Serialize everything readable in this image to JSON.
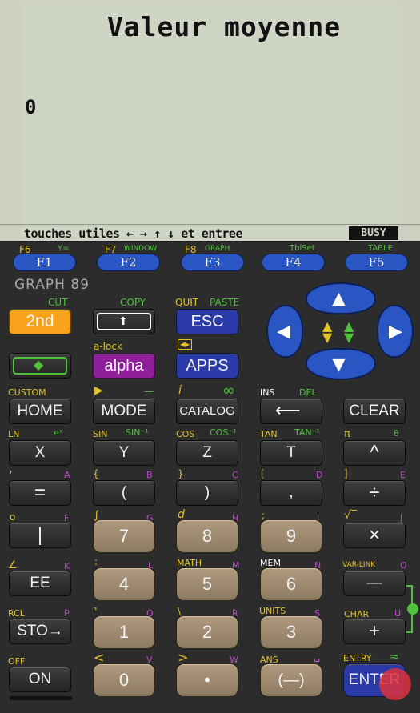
{
  "screen": {
    "title": "Valeur moyenne",
    "value": "0",
    "help": "touches utiles ← → ↑ ↓ et entree",
    "status": "BUSY"
  },
  "fkeys": [
    {
      "label": "F1",
      "top_left": "F6",
      "top_right": "Y="
    },
    {
      "label": "F2",
      "top_left": "F7",
      "top_right": "WINDOW"
    },
    {
      "label": "F3",
      "top_left": "F8",
      "top_right": "GRAPH"
    },
    {
      "label": "F4",
      "top_left": "",
      "top_right": "TblSet"
    },
    {
      "label": "F5",
      "top_left": "",
      "top_right": "TABLE"
    }
  ],
  "brand": "GRAPH 89",
  "row1": {
    "second": {
      "label": "2nd",
      "over_right": "CUT"
    },
    "shift": {
      "over_right": "COPY"
    },
    "esc": {
      "label": "ESC",
      "over_left": "QUIT",
      "over_right": "PASTE"
    }
  },
  "row2": {
    "diamond": {},
    "alpha": {
      "label": "alpha",
      "over_left": "a-lock"
    },
    "apps": {
      "label": "APPS"
    }
  },
  "row3": {
    "home": {
      "label": "HOME",
      "over_left": "CUSTOM"
    },
    "mode": {
      "label": "MODE",
      "over_right": "—"
    },
    "catalog": {
      "label": "CATALOG",
      "over_left": "i",
      "over_right": "∞"
    },
    "backspace": {
      "over_left": "INS",
      "over_right": "DEL"
    },
    "clear": {
      "label": "CLEAR"
    }
  },
  "row4": [
    {
      "label": "X",
      "over_left": "LN",
      "over_right": "eˣ"
    },
    {
      "label": "Y",
      "over_left": "SIN",
      "over_right": "SIN⁻¹"
    },
    {
      "label": "Z",
      "over_left": "COS",
      "over_right": "COS⁻¹"
    },
    {
      "label": "T",
      "over_left": "TAN",
      "over_right": "TAN⁻¹"
    },
    {
      "label": "^",
      "over_left": "π",
      "over_right": "θ"
    }
  ],
  "row5": [
    {
      "label": "=",
      "over_left": "'",
      "over_right": "A"
    },
    {
      "label": "(",
      "over_left": "{",
      "over_right": "B"
    },
    {
      "label": ")",
      "over_left": "}",
      "over_right": "C"
    },
    {
      "label": ",",
      "over_left": "[",
      "over_right": "D"
    },
    {
      "label": "÷",
      "over_left": "]",
      "over_right": "E"
    }
  ],
  "row6": [
    {
      "label": "|",
      "over_left": "o",
      "over_right": "F"
    },
    {
      "label": "7",
      "over_left": "∫",
      "over_right": "G"
    },
    {
      "label": "8",
      "over_left": "d",
      "over_right": "H"
    },
    {
      "label": "9",
      "over_left": ";",
      "over_right": "I"
    },
    {
      "label": "×",
      "over_left": "√‾",
      "over_right": "J"
    }
  ],
  "row7": [
    {
      "label": "EE",
      "over_left": "∠",
      "over_right": "K"
    },
    {
      "label": "4",
      "over_left": ":",
      "over_right": "L"
    },
    {
      "label": "5",
      "over_left": "MATH",
      "over_right": "M"
    },
    {
      "label": "6",
      "over_left": "MEM",
      "over_right": "N"
    },
    {
      "label": "—",
      "over_left": "VAR-LINK",
      "over_right": "O"
    }
  ],
  "row8": [
    {
      "label": "STO→",
      "over_left": "RCL",
      "over_right": "P"
    },
    {
      "label": "1",
      "over_left": "\"",
      "over_right": "Q"
    },
    {
      "label": "2",
      "over_left": "\\",
      "over_right": "R"
    },
    {
      "label": "3",
      "over_left": "UNITS",
      "over_right": "S"
    },
    {
      "label": "+",
      "over_left": "CHAR",
      "over_right": "U"
    }
  ],
  "row9": [
    {
      "label": "ON",
      "over_left": "OFF",
      "over_right": ""
    },
    {
      "label": "0",
      "over_left": "<",
      "over_right": "V"
    },
    {
      "label": "•",
      "over_left": ">",
      "over_right": "W"
    },
    {
      "label": "(—)",
      "over_left": "ANS",
      "over_right": "␣"
    },
    {
      "label": "ENTER",
      "over_left": "ENTRY",
      "over_right": "≈"
    }
  ]
}
